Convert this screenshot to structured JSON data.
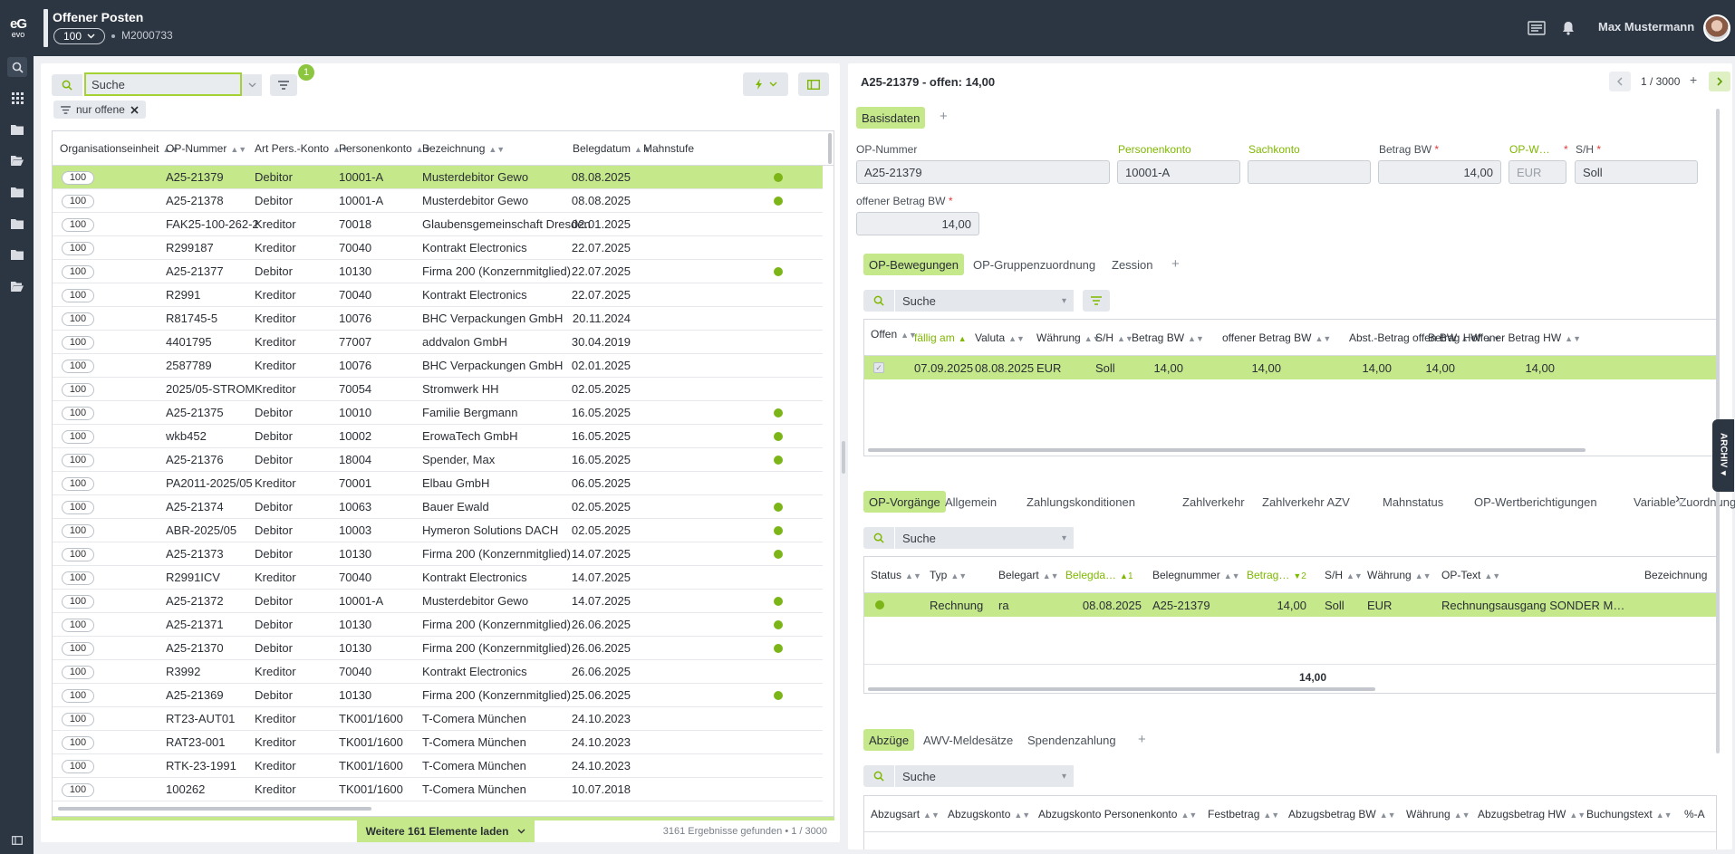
{
  "app": {
    "logo_mark": "eG",
    "logo_text": "evo",
    "title": "Offener Posten",
    "client": "100",
    "record_number": "M2000733",
    "user_name": "Max Mustermann"
  },
  "list": {
    "search_placeholder": "Suche",
    "filter_badge": "1",
    "active_filter": "nur offene",
    "columns": [
      "Organisationseinheit",
      "OP-Nummer",
      "Art Pers.-Konto",
      "Personenkonto",
      "Bezeichnung",
      "Belegdatum",
      "Mahnstufe"
    ],
    "rows": [
      {
        "org": "100",
        "op": "A25-21379",
        "art": "Debitor",
        "konto": "10001-A",
        "bez": "Musterdebitor Gewo",
        "datum": "08.08.2025",
        "mahn": true
      },
      {
        "org": "100",
        "op": "A25-21378",
        "art": "Debitor",
        "konto": "10001-A",
        "bez": "Musterdebitor Gewo",
        "datum": "08.08.2025",
        "mahn": true
      },
      {
        "org": "100",
        "op": "FAK25-100-262-2",
        "art": "Kreditor",
        "konto": "70018",
        "bez": "Glaubensgemeinschaft Dresden",
        "datum": "02.01.2025",
        "mahn": false
      },
      {
        "org": "100",
        "op": "R299187",
        "art": "Kreditor",
        "konto": "70040",
        "bez": "Kontrakt Electronics",
        "datum": "22.07.2025",
        "mahn": false
      },
      {
        "org": "100",
        "op": "A25-21377",
        "art": "Debitor",
        "konto": "10130",
        "bez": "Firma 200 (Konzernmitglied)",
        "datum": "22.07.2025",
        "mahn": true
      },
      {
        "org": "100",
        "op": "R2991",
        "art": "Kreditor",
        "konto": "70040",
        "bez": "Kontrakt Electronics",
        "datum": "22.07.2025",
        "mahn": false
      },
      {
        "org": "100",
        "op": "R81745-5",
        "art": "Kreditor",
        "konto": "10076",
        "bez": "BHC Verpackungen GmbH",
        "datum": "20.11.2024",
        "mahn": false
      },
      {
        "org": "100",
        "op": "4401795",
        "art": "Kreditor",
        "konto": "77007",
        "bez": "addvalon GmbH",
        "datum": "30.04.2019",
        "mahn": false
      },
      {
        "org": "100",
        "op": "2587789",
        "art": "Kreditor",
        "konto": "10076",
        "bez": "BHC Verpackungen GmbH",
        "datum": "02.01.2025",
        "mahn": false
      },
      {
        "org": "100",
        "op": "2025/05-STROM",
        "art": "Kreditor",
        "konto": "70054",
        "bez": "Stromwerk HH",
        "datum": "02.05.2025",
        "mahn": false
      },
      {
        "org": "100",
        "op": "A25-21375",
        "art": "Debitor",
        "konto": "10010",
        "bez": "Familie Bergmann",
        "datum": "16.05.2025",
        "mahn": true
      },
      {
        "org": "100",
        "op": "wkb452",
        "art": "Debitor",
        "konto": "10002",
        "bez": "ErowaTech GmbH",
        "datum": "16.05.2025",
        "mahn": true
      },
      {
        "org": "100",
        "op": "A25-21376",
        "art": "Debitor",
        "konto": "18004",
        "bez": "Spender, Max",
        "datum": "16.05.2025",
        "mahn": true
      },
      {
        "org": "100",
        "op": "PA2011-2025/05",
        "art": "Kreditor",
        "konto": "70001",
        "bez": "Elbau GmbH",
        "datum": "06.05.2025",
        "mahn": false
      },
      {
        "org": "100",
        "op": "A25-21374",
        "art": "Debitor",
        "konto": "10063",
        "bez": "Bauer Ewald",
        "datum": "02.05.2025",
        "mahn": true
      },
      {
        "org": "100",
        "op": "ABR-2025/05",
        "art": "Debitor",
        "konto": "10003",
        "bez": "Hymeron Solutions DACH",
        "datum": "02.05.2025",
        "mahn": true
      },
      {
        "org": "100",
        "op": "A25-21373",
        "art": "Debitor",
        "konto": "10130",
        "bez": "Firma 200 (Konzernmitglied)",
        "datum": "14.07.2025",
        "mahn": true
      },
      {
        "org": "100",
        "op": "R2991ICV",
        "art": "Kreditor",
        "konto": "70040",
        "bez": "Kontrakt Electronics",
        "datum": "14.07.2025",
        "mahn": false
      },
      {
        "org": "100",
        "op": "A25-21372",
        "art": "Debitor",
        "konto": "10001-A",
        "bez": "Musterdebitor Gewo",
        "datum": "14.07.2025",
        "mahn": true
      },
      {
        "org": "100",
        "op": "A25-21371",
        "art": "Debitor",
        "konto": "10130",
        "bez": "Firma 200 (Konzernmitglied)",
        "datum": "26.06.2025",
        "mahn": true
      },
      {
        "org": "100",
        "op": "A25-21370",
        "art": "Debitor",
        "konto": "10130",
        "bez": "Firma 200 (Konzernmitglied)",
        "datum": "26.06.2025",
        "mahn": true
      },
      {
        "org": "100",
        "op": "R3992",
        "art": "Kreditor",
        "konto": "70040",
        "bez": "Kontrakt Electronics",
        "datum": "26.06.2025",
        "mahn": false
      },
      {
        "org": "100",
        "op": "A25-21369",
        "art": "Debitor",
        "konto": "10130",
        "bez": "Firma 200 (Konzernmitglied)",
        "datum": "25.06.2025",
        "mahn": true
      },
      {
        "org": "100",
        "op": "RT23-AUT01",
        "art": "Kreditor",
        "konto": "TK001/1600",
        "bez": "T-Comera München",
        "datum": "24.10.2023",
        "mahn": false
      },
      {
        "org": "100",
        "op": "RAT23-001",
        "art": "Kreditor",
        "konto": "TK001/1600",
        "bez": "T-Comera München",
        "datum": "24.10.2023",
        "mahn": false
      },
      {
        "org": "100",
        "op": "RTK-23-1991",
        "art": "Kreditor",
        "konto": "TK001/1600",
        "bez": "T-Comera München",
        "datum": "24.10.2023",
        "mahn": false
      },
      {
        "org": "100",
        "op": "100262",
        "art": "Kreditor",
        "konto": "TK001/1600",
        "bez": "T-Comera München",
        "datum": "10.07.2018",
        "mahn": false
      }
    ],
    "load_more": "Weitere 161 Elemente laden",
    "results": "3161 Ergebnisse gefunden  •  1 / 3000"
  },
  "detail": {
    "title": "A25-21379 - offen: 14,00",
    "pager": "1 / 3000",
    "tabs": [
      "Basisdaten"
    ],
    "fields": {
      "op_nummer_label": "OP-Nummer",
      "op_nummer": "A25-21379",
      "personenkonto_label": "Personenkonto",
      "personenkonto": "10001-A",
      "sachkonto_label": "Sachkonto",
      "sachkonto": "",
      "betrag_bw_label": "Betrag BW",
      "betrag_bw": "14,00",
      "op_waehrung_label": "OP-W…",
      "op_waehrung": "EUR",
      "sh_label": "S/H",
      "sh": "Soll",
      "offener_betrag_label": "offener Betrag BW",
      "offener_betrag": "14,00"
    },
    "bewegungen": {
      "tabs": [
        "OP-Bewegungen",
        "OP-Gruppenzuordnung",
        "Zession"
      ],
      "search_placeholder": "Suche",
      "columns": [
        "Offen",
        "fällig am",
        "Valuta",
        "Währung",
        "S/H",
        "Betrag BW",
        "offener Betrag BW",
        "Abst.-Betrag offen BW",
        "Betrag HW",
        "offener Betrag HW"
      ],
      "row": {
        "faellig": "07.09.2025",
        "valuta": "08.08.2025",
        "waehrung": "EUR",
        "sh": "Soll",
        "betrag_bw": "14,00",
        "offen_bw": "14,00",
        "abst": "14,00",
        "betrag_hw": "14,00",
        "offen_hw": "14,00"
      }
    },
    "vorgaenge": {
      "tabs": [
        "OP-Vorgänge",
        "Allgemein",
        "Zahlungskonditionen",
        "Zahlverkehr",
        "Zahlverkehr AZV",
        "Mahnstatus",
        "OP-Wertberichtigungen",
        "Variable Zuordnungen",
        "V"
      ],
      "search_placeholder": "Suche",
      "columns": [
        "Status",
        "Typ",
        "Belegart",
        "Belegda…",
        "Belegnummer",
        "Betrag…",
        "S/H",
        "Währung",
        "OP-Text",
        "Bezeichnung"
      ],
      "sort_badges": [
        "1",
        "2"
      ],
      "row": {
        "typ": "Rechnung",
        "belegart": "ra",
        "belegdatum": "08.08.2025",
        "belegnummer": "A25-21379",
        "betrag": "14,00",
        "sh": "Soll",
        "waehrung": "EUR",
        "optext": "Rechnungsausgang SONDER M…"
      },
      "sum": "14,00"
    },
    "abzuege": {
      "tabs": [
        "Abzüge",
        "AWV-Meldesätze",
        "Spendenzahlung"
      ],
      "search_placeholder": "Suche",
      "columns": [
        "Abzugsart",
        "Abzugskonto",
        "Abzugskonto Personenkonto",
        "Festbetrag",
        "Abzugsbetrag BW",
        "Währung",
        "Abzugsbetrag HW",
        "Buchungstext",
        "%-A"
      ]
    },
    "archiv_label": "ARCHIV"
  },
  "colors": {
    "accent": "#8cc63f",
    "selected_row": "#c4e88a",
    "topbar": "#2c3542"
  }
}
